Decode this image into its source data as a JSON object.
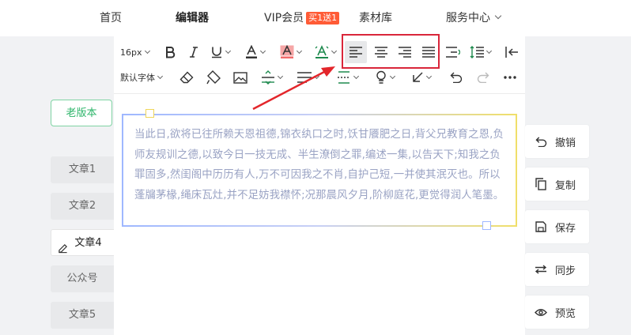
{
  "nav": {
    "home": "首页",
    "editor": "编辑器",
    "vip": "VIP会员",
    "vip_badge": "买1送1",
    "materials": "素材库",
    "service": "服务中心"
  },
  "left": {
    "old_version": "老版本",
    "articles": [
      "文章1",
      "文章2",
      "文章4",
      "公众号",
      "文章5"
    ]
  },
  "toolbar": {
    "font_size": "16px",
    "font_family": "默认字体"
  },
  "content": {
    "text": "当此日,欲将已往所赖天恩祖德,锦衣纨口之时,饫甘餍肥之日,背父兄教育之恩,负师友规训之德,以致今日一技无成、半生潦倒之罪,编述一集,以告天下;知我之负罪固多,然闺阁中历历有人,万不可因我之不肖,自护己短,一并使其泯灭也。所以蓬牖茅椽,绳床瓦灶,并不足妨我襟怀;况那晨风夕月,阶柳庭花,更觉得润人笔墨。"
  },
  "right": {
    "undo": "撤销",
    "copy": "复制",
    "save": "保存",
    "sync": "同步",
    "preview": "预览"
  },
  "colors": {
    "accent_green": "#2db56a",
    "highlight_red": "#d9263a",
    "vip_badge": "#ff5b36"
  }
}
